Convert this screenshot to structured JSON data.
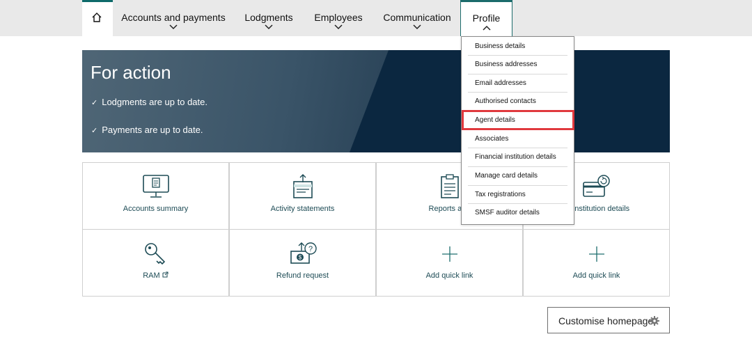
{
  "nav": {
    "home_icon": "home-icon",
    "items": [
      {
        "label": "Accounts and payments"
      },
      {
        "label": "Lodgments"
      },
      {
        "label": "Employees"
      },
      {
        "label": "Communication"
      },
      {
        "label": "Profile"
      }
    ]
  },
  "banner": {
    "title": "For action",
    "lines": [
      "Lodgments are up to date.",
      "Payments are up to date."
    ]
  },
  "tiles": [
    {
      "label": "Accounts summary",
      "icon": "monitor-document-icon"
    },
    {
      "label": "Activity statements",
      "icon": "upload-statement-icon"
    },
    {
      "label": "Reports and",
      "icon": "clipboard-icon"
    },
    {
      "label": "ial institution details",
      "icon": "card-refresh-icon"
    },
    {
      "label": "RAM",
      "icon": "key-icon",
      "external_icon": "external-link-icon"
    },
    {
      "label": "Refund request",
      "icon": "money-question-icon"
    },
    {
      "label": "Add quick link",
      "icon": "plus-icon"
    },
    {
      "label": "Add quick link",
      "icon": "plus-icon"
    }
  ],
  "profile_menu": {
    "items": [
      "Business details",
      "Business addresses",
      "Email addresses",
      "Authorised contacts",
      "Agent details",
      "Associates",
      "Financial institution details",
      "Manage card details",
      "Tax registrations",
      "SMSF auditor details"
    ],
    "highlighted": "Agent details"
  },
  "customise": {
    "label": "Customise homepage",
    "icon": "gear-icon"
  },
  "colors": {
    "accent": "#1b6b6b",
    "banner": "#0b2740",
    "highlight": "#e0393e",
    "link_text": "#1d4b55"
  }
}
